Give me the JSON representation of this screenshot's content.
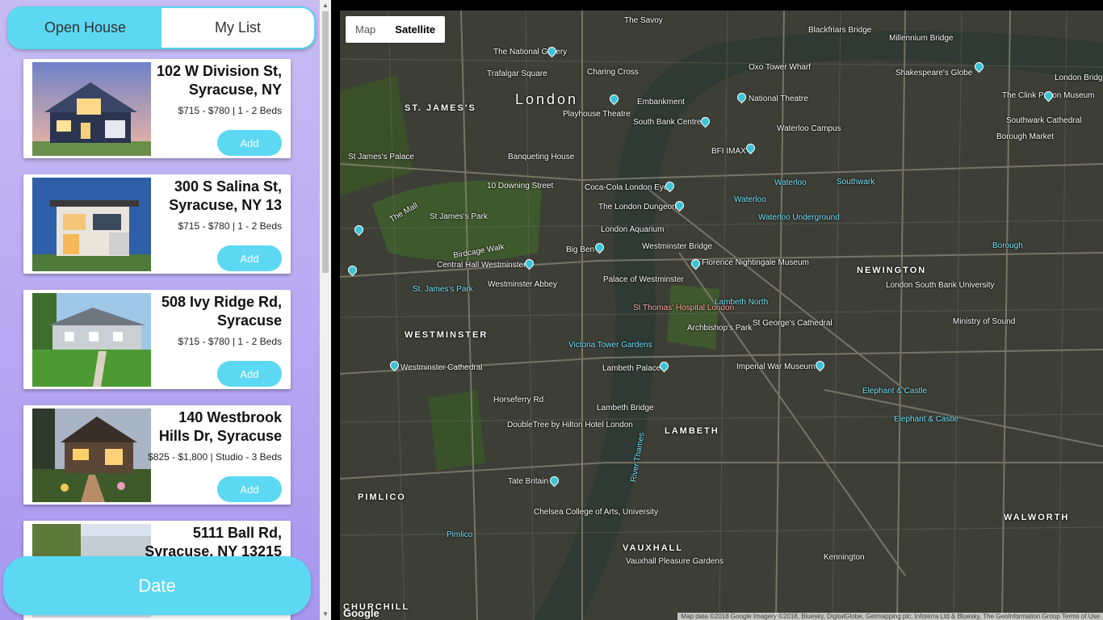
{
  "tabs": {
    "open_house": "Open House",
    "my_list": "My List"
  },
  "listings": [
    {
      "address": "102 W Division St, Syracuse, NY",
      "price": "$715 - $780 | 1 - 2 Beds",
      "add_label": "Add"
    },
    {
      "address": "300 S Salina St, Syracuse, NY 13",
      "price": "$715 - $780 | 1 - 2 Beds",
      "add_label": "Add"
    },
    {
      "address": "508 Ivy Ridge Rd, Syracuse",
      "price": "$715 - $780 | 1 - 2 Beds",
      "add_label": "Add"
    },
    {
      "address": "140 Westbrook Hills Dr, Syracuse",
      "price": "$825 - $1,800 | Studio - 3 Beds",
      "add_label": "Add"
    },
    {
      "address": "5111 Ball Rd, Syracuse, NY 13215",
      "price": "",
      "add_label": ""
    }
  ],
  "date_button": "Date",
  "map": {
    "type_map": "Map",
    "type_satellite": "Satellite",
    "selected": "Satellite",
    "google": "Google",
    "attribution": "Map data ©2018 Google Imagery ©2018, Bluesky, DigitalGlobe, Getmapping plc, Infoterra Ltd & Bluesky, The GeoInformation Group  Terms of Use",
    "labels": {
      "london": "London",
      "st_james": "ST. JAMES'S",
      "westminster": "WESTMINSTER",
      "lambeth": "LAMBETH",
      "newington": "NEWINGTON",
      "walworth": "WALWORTH",
      "pimlico": "PIMLICO",
      "vauxhall": "VAUXHALL",
      "churchill": "CHURCHILL",
      "national_gallery": "The National Gallery",
      "trafalgar": "Trafalgar Square",
      "charing_cross": "Charing Cross",
      "embankment": "Embankment",
      "savoy": "The Savoy",
      "blackfriars": "Blackfriars Bridge",
      "millennium": "Millennium Bridge",
      "oxo": "Oxo Tower Wharf",
      "shakespeare": "Shakespeare's Globe",
      "clink": "The Clink Prison Museum",
      "southwark_cathedral": "Southwark Cathedral",
      "borough_market": "Borough Market",
      "london_bridge": "London Bridge",
      "national_theatre": "National Theatre",
      "playhouse": "Playhouse Theatre",
      "south_bank": "South Bank Centre",
      "waterloo_campus": "Waterloo Campus",
      "bfi": "BFI IMAX",
      "banqueting": "Banqueting House",
      "st_james_palace": "St James's Palace",
      "downing": "10 Downing Street",
      "coca_cola": "Coca-Cola London Eye",
      "dungeon": "The London Dungeon",
      "aquarium": "London Aquarium",
      "big_ben": "Big Ben",
      "westminster_bridge": "Westminster Bridge",
      "florence": "Florence Nightingale Museum",
      "waterloo": "Waterloo",
      "southwark": "Southwark",
      "waterloo_underground": "Waterloo Underground",
      "st_james_park": "St. James's Park",
      "central_hall": "Central Hall Westminster",
      "westminster_abbey": "Westminster Abbey",
      "palace_westminster": "Palace of Westminster",
      "st_thomas": "St Thomas' Hospital London",
      "archbishop": "Archbishop's Park",
      "lambeth_north": "Lambeth North",
      "st_georges": "St George's Cathedral",
      "london_south_bank": "London South Bank University",
      "ministry_sound": "Ministry of Sound",
      "borough": "Borough",
      "victoria_tower": "Victoria Tower Gardens",
      "westminster_cathedral": "Westminster Cathedral",
      "lambeth_palace": "Lambeth Palace",
      "imperial_war": "Imperial War Museum",
      "elephant": "Elephant & Castle",
      "doubletree": "DoubleTree by Hilton Hotel London",
      "tate": "Tate Britain",
      "chelsea_college": "Chelsea College of Arts, University",
      "river_thames": "River Thames",
      "vauxhall_gardens": "Vauxhall Pleasure Gardens",
      "kennington": "Kennington",
      "pimlico_station": "Pimlico",
      "lambeth_bridge": "Lambeth Bridge",
      "horseferry": "Horseferry Rd",
      "st_james_park_label": "St James's Park",
      "the_mall": "The Mall",
      "birdcage": "Birdcage Walk"
    }
  }
}
